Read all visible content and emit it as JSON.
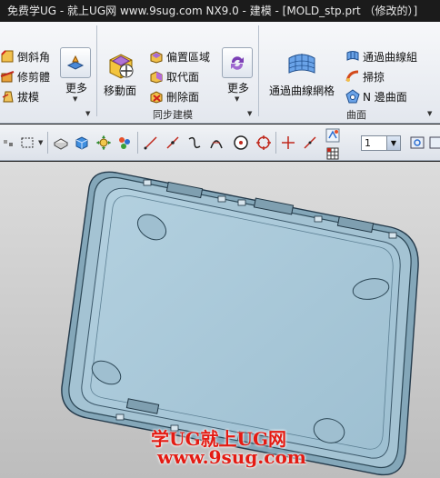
{
  "window": {
    "title": "免费学UG - 就上UG网 www.9sug.com   NX9.0 - 建模 - [MOLD_stp.prt （修改的）]"
  },
  "ribbon": {
    "group1": {
      "items": [
        "倒斜角",
        "修剪體",
        "拔模"
      ],
      "more_label": "更多"
    },
    "group2": {
      "label": "同步建模",
      "big_button": "移動面",
      "items": [
        "偏置區域",
        "取代面",
        "刪除面"
      ],
      "more_label": "更多"
    },
    "group3": {
      "label": "曲面",
      "big_button": "通過曲線網格",
      "items": [
        "通過曲線組",
        "掃掠",
        "N 邊曲面"
      ]
    }
  },
  "toolbar": {
    "layer_value": "1"
  },
  "viewport": {
    "watermark_line1": "学UG就上UG网",
    "watermark_line2": "www.9sug.com"
  },
  "colors": {
    "part_fill": "#a9c8d8",
    "part_edge": "#2c4756",
    "watermark": "#e41b13"
  }
}
